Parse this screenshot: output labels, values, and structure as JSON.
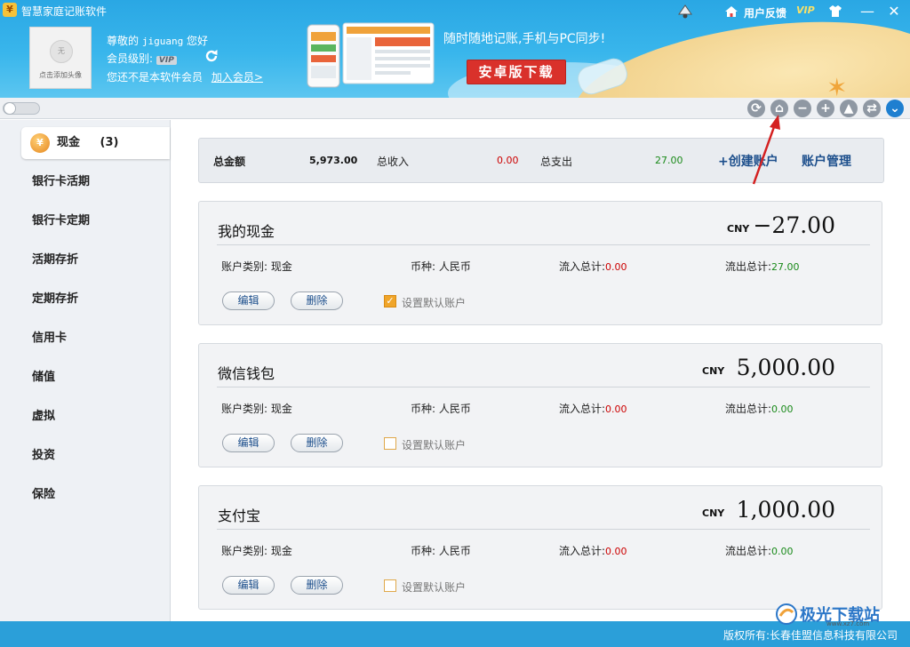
{
  "window": {
    "title": "智慧家庭记账软件",
    "feedback": "用户反馈",
    "vip": "VIP",
    "minimize": "—",
    "close": "✕"
  },
  "user": {
    "avatar_placeholder": "无",
    "avatar_hint": "点击添加头像",
    "greeting_prefix": "尊敬的",
    "username": "jiguang",
    "greeting_suffix": "您好",
    "level_label": "会员级别:",
    "level_badge": "VIP",
    "not_member": "您还不是本软件会员",
    "join_link": "加入会员>"
  },
  "promo": {
    "text": "随时随地记账,手机与PC同步!",
    "android_button": "安卓版下载"
  },
  "toolbar": {
    "icons": [
      "refresh-icon",
      "home-icon",
      "minus-icon",
      "plus-icon",
      "landscape-icon",
      "swap-icon",
      "chevron-down-icon"
    ]
  },
  "sidebar": {
    "items": [
      {
        "label": "现金",
        "count": "(3)",
        "active": true
      },
      {
        "label": "银行卡活期"
      },
      {
        "label": "银行卡定期"
      },
      {
        "label": "活期存折"
      },
      {
        "label": "定期存折"
      },
      {
        "label": "信用卡"
      },
      {
        "label": "储值"
      },
      {
        "label": "虚拟"
      },
      {
        "label": "投资"
      },
      {
        "label": "保险"
      }
    ]
  },
  "summary": {
    "total_label": "总金额",
    "total_value": "5,973.00",
    "income_label": "总收入",
    "income_value": "0.00",
    "expense_label": "总支出",
    "expense_value": "27.00",
    "create_link": "+创建账户",
    "manage_link": "账户管理"
  },
  "accounts": [
    {
      "name": "我的现金",
      "currency": "CNY",
      "amount": "−27.00",
      "type_label": "账户类别:",
      "type_value": "现金",
      "currency_label": "币种:",
      "currency_value": "人民币",
      "inflow_label": "流入总计:",
      "inflow_value": "0.00",
      "outflow_label": "流出总计:",
      "outflow_value": "27.00",
      "edit": "编辑",
      "delete": "删除",
      "default_label": "设置默认账户",
      "default_checked": true
    },
    {
      "name": "微信钱包",
      "currency": "CNY",
      "amount": "5,000.00",
      "type_label": "账户类别:",
      "type_value": "现金",
      "currency_label": "币种:",
      "currency_value": "人民币",
      "inflow_label": "流入总计:",
      "inflow_value": "0.00",
      "outflow_label": "流出总计:",
      "outflow_value": "0.00",
      "edit": "编辑",
      "delete": "删除",
      "default_label": "设置默认账户",
      "default_checked": false
    },
    {
      "name": "支付宝",
      "currency": "CNY",
      "amount": "1,000.00",
      "type_label": "账户类别:",
      "type_value": "现金",
      "currency_label": "币种:",
      "currency_value": "人民币",
      "inflow_label": "流入总计:",
      "inflow_value": "0.00",
      "outflow_label": "流出总计:",
      "outflow_value": "0.00",
      "edit": "编辑",
      "delete": "删除",
      "default_label": "设置默认账户",
      "default_checked": false
    }
  ],
  "footer": {
    "copyright": "版权所有:长春佳盟信息科技有限公司"
  },
  "watermark": {
    "text": "极光下载站",
    "sub": "www.xz7.com"
  },
  "colors": {
    "header": "#2aa7e4",
    "footer": "#2b9fd9",
    "income_red": "#c00000",
    "expense_green": "#1a8a1a",
    "link_blue": "#1d4f8c",
    "android_red": "#d9312b"
  }
}
